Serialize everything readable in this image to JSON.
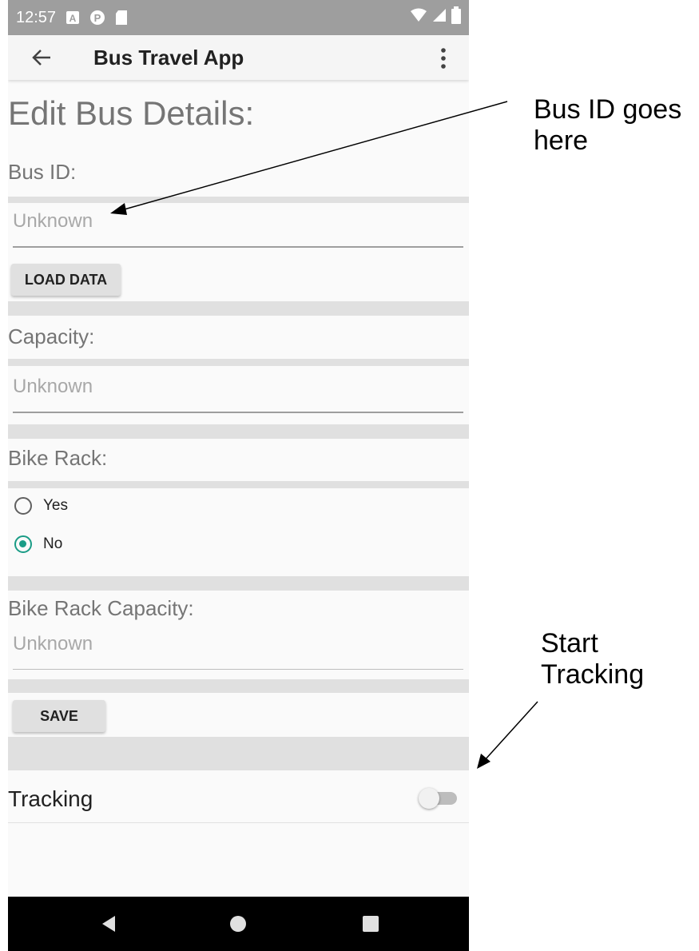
{
  "status_bar": {
    "time": "12:57"
  },
  "app_bar": {
    "title": "Bus Travel App"
  },
  "page": {
    "title": "Edit Bus Details:"
  },
  "bus_id": {
    "label": "Bus ID:",
    "placeholder": "Unknown",
    "load_button": "LOAD DATA"
  },
  "capacity": {
    "label": "Capacity:",
    "placeholder": "Unknown"
  },
  "bike_rack": {
    "label": "Bike Rack:",
    "options": [
      {
        "label": "Yes",
        "selected": false
      },
      {
        "label": "No",
        "selected": true
      }
    ]
  },
  "bike_rack_capacity": {
    "label": "Bike Rack Capacity:",
    "placeholder": "Unknown"
  },
  "save_button": "SAVE",
  "tracking": {
    "label": "Tracking",
    "enabled": false
  },
  "annotations": {
    "bus_id_note": "Bus ID goes here",
    "tracking_note": "Start Tracking"
  },
  "colors": {
    "accent": "#1a9c86",
    "status_bar": "#9e9e9e",
    "divider": "#e0e0e0"
  },
  "icons": [
    "back-arrow-icon",
    "overflow-menu-icon",
    "wifi-icon",
    "signal-icon",
    "battery-icon",
    "nav-back-icon",
    "nav-home-icon",
    "nav-recents-icon"
  ]
}
